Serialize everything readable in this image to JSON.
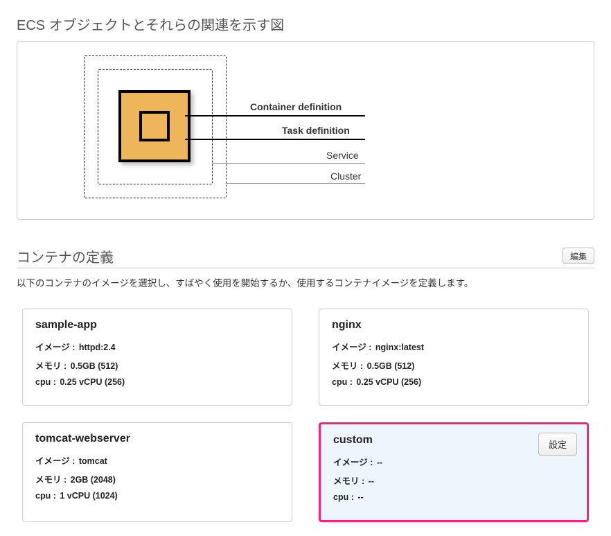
{
  "diagram": {
    "title": "ECS オブジェクトとそれらの関連を示す図",
    "labels": {
      "container_def": "Container definition",
      "task_def": "Task definition",
      "service": "Service",
      "cluster": "Cluster"
    }
  },
  "definition": {
    "title": "コンテナの定義",
    "edit_label": "編集",
    "subtitle": "以下のコンテナのイメージを選択し、すばやく使用を開始するか、使用するコンテナイメージを定義します。"
  },
  "labels": {
    "image": "イメージ :",
    "memory": "メモリ :",
    "cpu": "cpu :"
  },
  "cards": [
    {
      "name": "sample-app",
      "image": "httpd:2.4",
      "memory": "0.5GB (512)",
      "cpu": "0.25 vCPU (256)",
      "highlight": false
    },
    {
      "name": "nginx",
      "image": "nginx:latest",
      "memory": "0.5GB (512)",
      "cpu": "0.25 vCPU (256)",
      "highlight": false
    },
    {
      "name": "tomcat-webserver",
      "image": "tomcat",
      "memory": "2GB (2048)",
      "cpu": "1 vCPU (1024)",
      "highlight": false
    },
    {
      "name": "custom",
      "image": "--",
      "memory": "--",
      "cpu": "--",
      "highlight": true,
      "button": "設定"
    }
  ]
}
